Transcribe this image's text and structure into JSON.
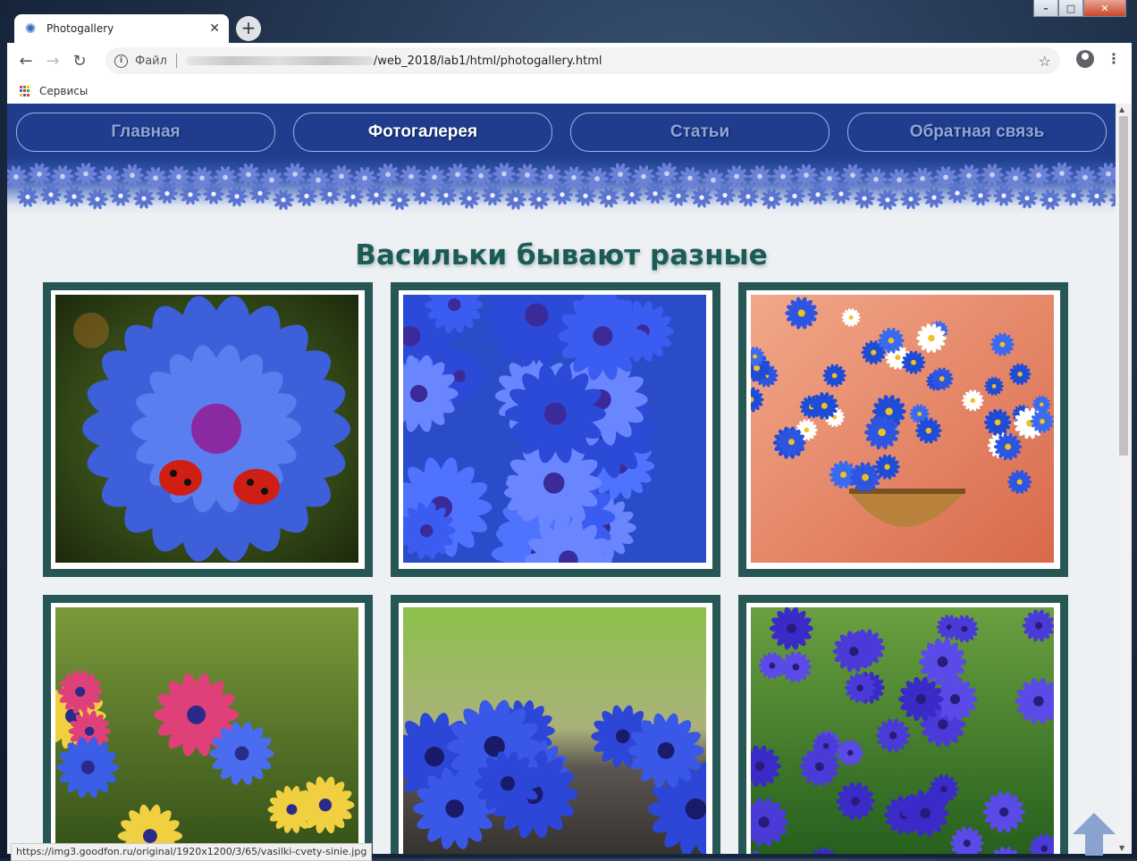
{
  "window": {
    "minimize": "–",
    "maximize": "□",
    "close": "✕"
  },
  "tab": {
    "title": "Photogallery",
    "favicon": "cornflower-icon",
    "close": "✕"
  },
  "toolbar": {
    "back": "←",
    "forward": "→",
    "reload": "↻",
    "scheme_label": "Файл",
    "url_tail": "/web_2018/lab1/html/photogallery.html",
    "star": "☆",
    "menu": "⋮"
  },
  "bookmarks": {
    "apps_label": "Сервисы"
  },
  "site": {
    "nav": [
      {
        "label": "Главная",
        "active": false
      },
      {
        "label": "Фотогалерея",
        "active": true
      },
      {
        "label": "Статьи",
        "active": false
      },
      {
        "label": "Обратная связь",
        "active": false
      }
    ],
    "heading": "Васильки бывают разные"
  },
  "gallery": [
    {
      "subject": "cornflower with ladybugs"
    },
    {
      "subject": "blue cornflowers close-up"
    },
    {
      "subject": "painted cornflowers in basket"
    },
    {
      "subject": "cornflowers in meadow"
    },
    {
      "subject": "cornflowers on wood"
    },
    {
      "subject": "cornflower field"
    }
  ],
  "status_bar": {
    "url": "https://img3.goodfon.ru/original/1920x1200/3/65/vasilki-cvety-sinie.jpg"
  },
  "scrollbar": {
    "up": "▲",
    "down": "▼"
  },
  "colors": {
    "nav_bg": "#1f3c8d",
    "frame": "#265755",
    "heading": "#1c5a56",
    "page_bg": "#eef1f3",
    "scroll_arrow": "#8aa2cf"
  }
}
